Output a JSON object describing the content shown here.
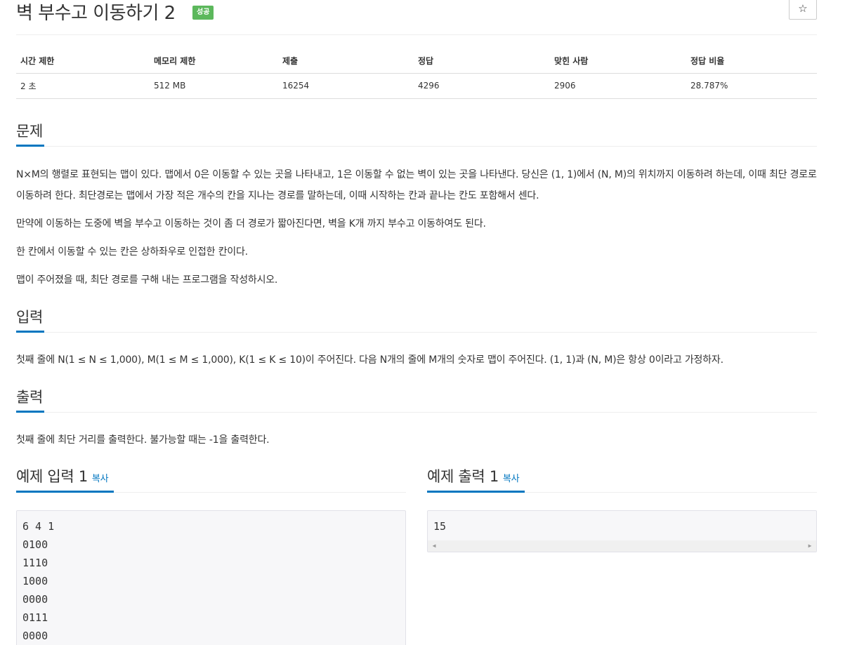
{
  "problem": {
    "title": "벽 부수고 이동하기 2",
    "badge": "성공",
    "star": "☆"
  },
  "info_table": {
    "headers": [
      "시간 제한",
      "메모리 제한",
      "제출",
      "정답",
      "맞힌 사람",
      "정답 비율"
    ],
    "values": [
      "2 초",
      "512 MB",
      "16254",
      "4296",
      "2906",
      "28.787%"
    ]
  },
  "sections": {
    "description": {
      "title": "문제",
      "paragraphs": [
        "N×M의 행렬로 표현되는 맵이 있다. 맵에서 0은 이동할 수 있는 곳을 나타내고, 1은 이동할 수 없는 벽이 있는 곳을 나타낸다. 당신은 (1, 1)에서 (N, M)의 위치까지 이동하려 하는데, 이때 최단 경로로 이동하려 한다. 최단경로는 맵에서 가장 적은 개수의 칸을 지나는 경로를 말하는데, 이때 시작하는 칸과 끝나는 칸도 포함해서 센다.",
        "만약에 이동하는 도중에 벽을 부수고 이동하는 것이 좀 더 경로가 짧아진다면, 벽을 K개 까지 부수고 이동하여도 된다.",
        "한 칸에서 이동할 수 있는 칸은 상하좌우로 인접한 칸이다.",
        "맵이 주어졌을 때, 최단 경로를 구해 내는 프로그램을 작성하시오."
      ]
    },
    "input": {
      "title": "입력",
      "text": "첫째 줄에 N(1 ≤ N ≤ 1,000), M(1 ≤ M ≤ 1,000), K(1 ≤ K ≤ 10)이 주어진다. 다음 N개의 줄에 M개의 숫자로 맵이 주어진다. (1, 1)과 (N, M)은 항상 0이라고 가정하자."
    },
    "output": {
      "title": "출력",
      "text": "첫째 줄에 최단 거리를 출력한다. 불가능할 때는 -1을 출력한다."
    }
  },
  "samples": {
    "input": {
      "title": "예제 입력 1",
      "copy": "복사",
      "lines": [
        "6 4 1",
        "0100",
        "1110",
        "1000",
        "0000",
        "0111",
        "0000"
      ]
    },
    "output": {
      "title": "예제 출력 1",
      "copy": "복사",
      "lines": [
        "15"
      ],
      "scroll_left": "◀",
      "scroll_right": "▶"
    }
  }
}
